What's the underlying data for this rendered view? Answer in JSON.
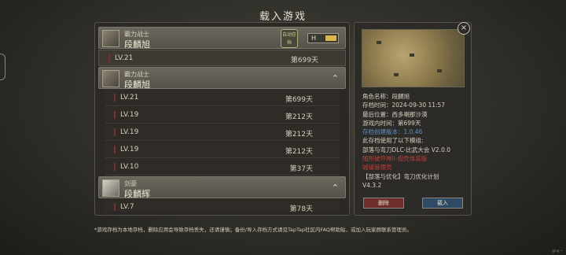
{
  "title": "载入游戏",
  "saves": [
    {
      "title": "霸力战士",
      "name": "段麟旭",
      "autosave_label": "自动存档",
      "toggle_mark": "H",
      "rows": [
        {
          "level": "LV.21",
          "day": "第699天",
          "selected": true
        }
      ]
    },
    {
      "title": "霸力战士",
      "name": "段麟旭",
      "chevron": "⌃",
      "rows": [
        {
          "level": "LV.21",
          "day": "第699天"
        },
        {
          "level": "LV.19",
          "day": "第212天"
        },
        {
          "level": "LV.19",
          "day": "第212天"
        },
        {
          "level": "LV.19",
          "day": "第212天"
        },
        {
          "level": "LV.10",
          "day": "第37天"
        }
      ]
    },
    {
      "title": "剑豪",
      "name": "段麟辉",
      "chevron": "⌃",
      "rows": [
        {
          "level": "LV.7",
          "day": "第78天"
        }
      ]
    }
  ],
  "footnote": "*游戏存档为本地存档，删除应用会导致存档丢失，还请谨慎；备份/导入存档方式请见TapTap社区内FAQ帮助贴，或加入玩家群联系管理员。",
  "detail": {
    "lines": [
      {
        "text": "角色名称：段麟旭",
        "style": ""
      },
      {
        "text": "存档时间：2024-09-30 11:57",
        "style": ""
      },
      {
        "text": "最后位置：西多喇那沙漠",
        "style": ""
      },
      {
        "text": "游戏内时间：第699天",
        "style": ""
      },
      {
        "text": "存档创建版本：1.0.46",
        "style": "blue"
      },
      {
        "text": "此存档使用了以下模组:",
        "style": ""
      },
      {
        "text": "部落与弯刀DLC-比武大会 V2.0.0",
        "style": ""
      },
      {
        "text": "随所破坏神II-炮壳体装版",
        "style": "red"
      },
      {
        "text": "城镇管理员",
        "style": "red"
      },
      {
        "text": "【部落与优化】弯刀优化计划",
        "style": ""
      },
      {
        "text": "V4.3.2",
        "style": ""
      }
    ],
    "delete_label": "删除",
    "load_label": "载入",
    "close_icon": "×"
  },
  "watermark": "@ng ~"
}
